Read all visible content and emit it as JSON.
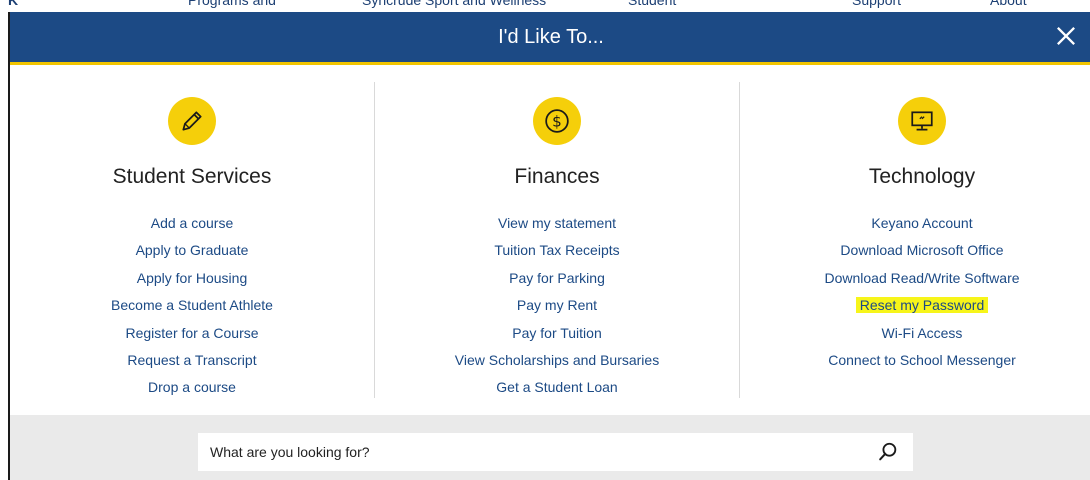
{
  "background_nav": {
    "items": [
      "Programs and",
      "Syncrude Sport and Wellness",
      "Student",
      "Support",
      "About"
    ]
  },
  "modal": {
    "title": "I'd Like To...",
    "close_icon": "close-icon"
  },
  "columns": [
    {
      "title": "Student Services",
      "icon": "pencil-icon",
      "links": [
        "Add a course",
        "Apply to Graduate",
        "Apply for Housing",
        "Become a Student Athlete",
        "Register for a Course",
        "Request a Transcript",
        "Drop a course"
      ]
    },
    {
      "title": "Finances",
      "icon": "dollar-icon",
      "links": [
        "View my statement",
        "Tuition Tax Receipts",
        "Pay for Parking",
        "Pay my Rent",
        "Pay for Tuition",
        "View Scholarships and Bursaries",
        "Get a Student Loan"
      ]
    },
    {
      "title": "Technology",
      "icon": "computer-icon",
      "links": [
        "Keyano Account",
        "Download Microsoft Office",
        "Download Read/Write Software",
        "Reset my Password",
        "Wi-Fi Access",
        "Connect to School Messenger"
      ],
      "highlighted_link": "Reset my Password"
    }
  ],
  "search": {
    "placeholder": "What are you looking for?",
    "icon": "search-icon"
  },
  "colors": {
    "header": "#1c4a85",
    "accent": "#f5cf0a",
    "link": "#1c4a85",
    "highlight": "#f7f51a"
  }
}
